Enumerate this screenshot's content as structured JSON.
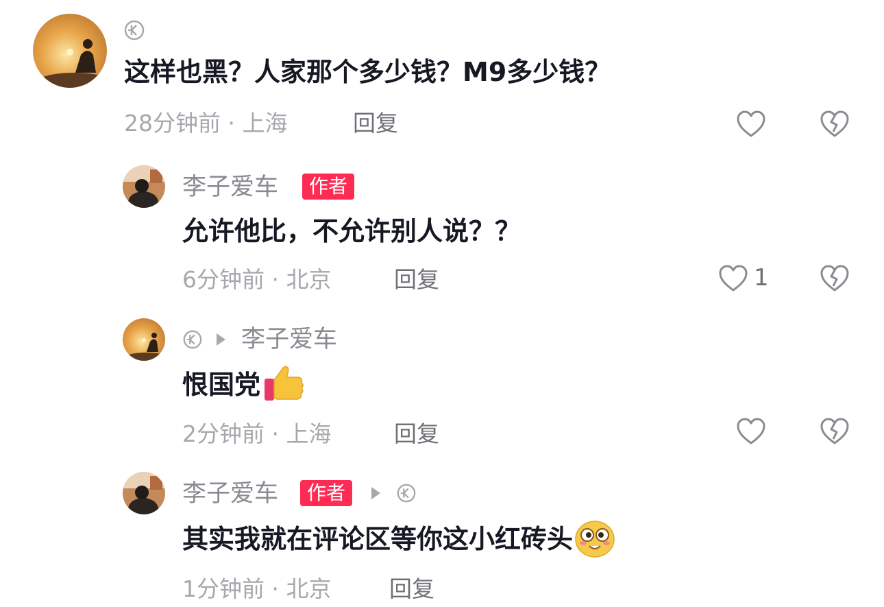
{
  "comments": [
    {
      "content": "这样也黑？人家那个多少钱？M9多少钱？",
      "time": "28分钟前",
      "location": "上海",
      "reply_label": "回复"
    },
    {
      "author": "李子爱车",
      "author_badge": "作者",
      "content": "允许他比，不允许别人说？？",
      "time": "6分钟前",
      "location": "北京",
      "reply_label": "回复",
      "likes": "1"
    },
    {
      "reply_to": "李子爱车",
      "content": "恨国党",
      "time": "2分钟前",
      "location": "上海",
      "reply_label": "回复"
    },
    {
      "author": "李子爱车",
      "author_badge": "作者",
      "content": "其实我就在评论区等你这小红砖头",
      "time": "1分钟前",
      "location": "北京",
      "reply_label": "回复"
    }
  ],
  "meta_separator": " · ",
  "colors": {
    "badge": "#fe2c55",
    "text_primary": "#161823",
    "text_secondary": "#a7a8ad"
  }
}
